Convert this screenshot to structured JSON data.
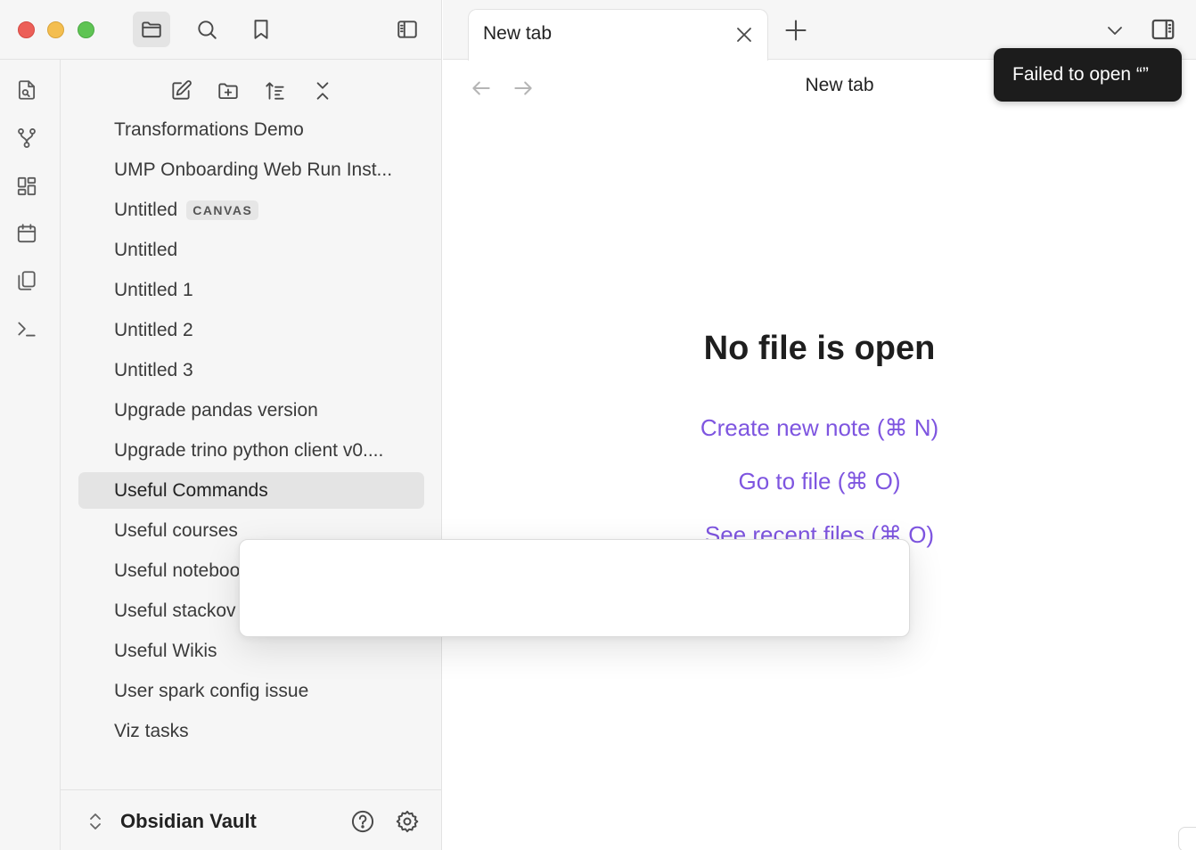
{
  "tabs": [
    {
      "label": "New tab"
    }
  ],
  "main": {
    "view_title": "New tab",
    "empty_state": {
      "title": "No file is open",
      "actions": [
        "Create new note (⌘ N)",
        "Go to file (⌘ O)",
        "See recent files (⌘ O)"
      ]
    }
  },
  "toast": {
    "text": "Failed to open “”"
  },
  "file_explorer": {
    "items": [
      {
        "label": "Transformations Demo",
        "badge": ""
      },
      {
        "label": "UMP Onboarding Web Run Inst...",
        "badge": ""
      },
      {
        "label": "Untitled",
        "badge": "CANVAS"
      },
      {
        "label": "Untitled",
        "badge": ""
      },
      {
        "label": "Untitled 1",
        "badge": ""
      },
      {
        "label": "Untitled 2",
        "badge": ""
      },
      {
        "label": "Untitled 3",
        "badge": ""
      },
      {
        "label": "Upgrade pandas version",
        "badge": ""
      },
      {
        "label": "Upgrade trino python client v0....",
        "badge": ""
      },
      {
        "label": "Useful Commands",
        "badge": "",
        "selected": true
      },
      {
        "label": "Useful courses",
        "badge": ""
      },
      {
        "label": "Useful noteboo",
        "badge": ""
      },
      {
        "label": "Useful stackov",
        "badge": ""
      },
      {
        "label": "Useful Wikis",
        "badge": ""
      },
      {
        "label": "User spark config issue",
        "badge": ""
      },
      {
        "label": "Viz tasks",
        "badge": ""
      }
    ]
  },
  "vault": {
    "name": "Obsidian Vault"
  },
  "icons": {
    "titlebar": [
      "folder-icon",
      "search-icon",
      "bookmark-icon",
      "sidebar-toggle-icon"
    ],
    "ribbon": [
      "open-quick-switcher-icon",
      "graph-view-icon",
      "canvas-icon",
      "daily-note-icon",
      "templates-icon",
      "command-palette-icon"
    ],
    "explorer_toolbar": [
      "new-note-icon",
      "new-folder-icon",
      "sort-icon",
      "collapse-all-icon"
    ],
    "vault_footer": [
      "help-icon",
      "settings-icon"
    ]
  },
  "colors": {
    "accent": "#7e55e0",
    "selected_bg": "#e4e4e4",
    "toast_bg": "#1c1c1c"
  }
}
